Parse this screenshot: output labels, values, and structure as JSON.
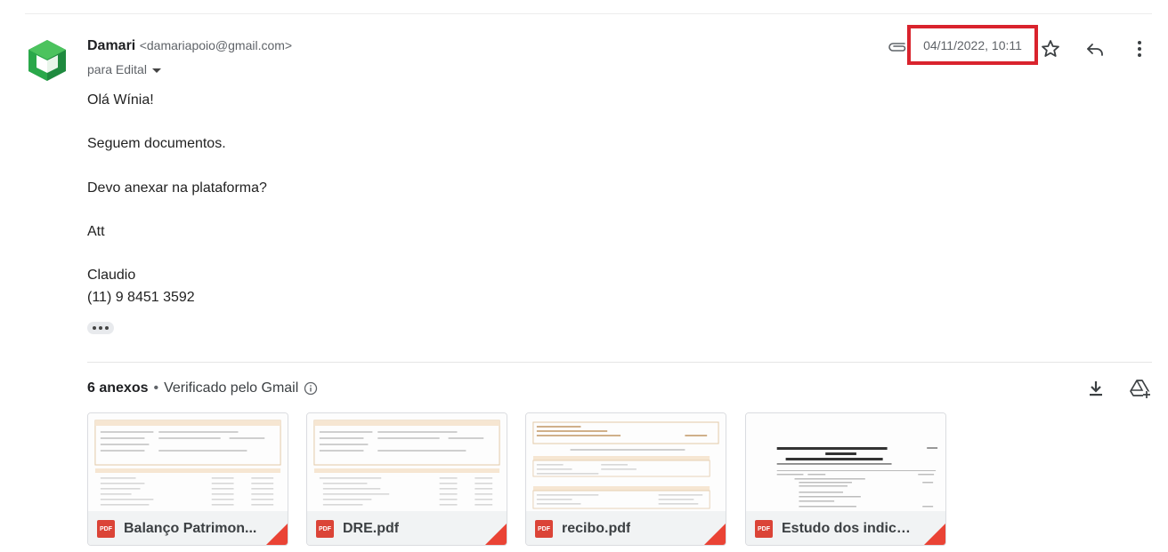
{
  "email": {
    "sender_name": "Damari",
    "sender_email": "<damariapoio@gmail.com>",
    "recipient": "para Edital",
    "date": "04/11/2022, 10:11",
    "body": {
      "greeting": "Olá Wínia!",
      "line1": "Seguem documentos.",
      "line2": "Devo anexar na plataforma?",
      "signoff": "Att",
      "signature_name": "Claudio",
      "signature_phone": "(11) 9 8451 3592"
    }
  },
  "attachments": {
    "count_label": "6 anexos",
    "separator": "•",
    "verified_label": "Verificado pelo Gmail",
    "badge_label": "PDF",
    "items": [
      {
        "name": "Balanço Patrimon..."
      },
      {
        "name": "DRE.pdf"
      },
      {
        "name": "recibo.pdf"
      },
      {
        "name": "Estudo dos indice..."
      }
    ]
  },
  "icons": {
    "avatar": "green-hexagon-logo",
    "attachment": "paperclip-icon",
    "star": "star-icon",
    "reply": "reply-icon",
    "more": "more-vert-icon",
    "info": "info-icon",
    "download": "download-icon",
    "drive": "add-to-drive-icon"
  },
  "colors": {
    "highlight": "#d9232d",
    "pdf_red": "#db4437",
    "avatar_green": "#2e9e4f"
  }
}
